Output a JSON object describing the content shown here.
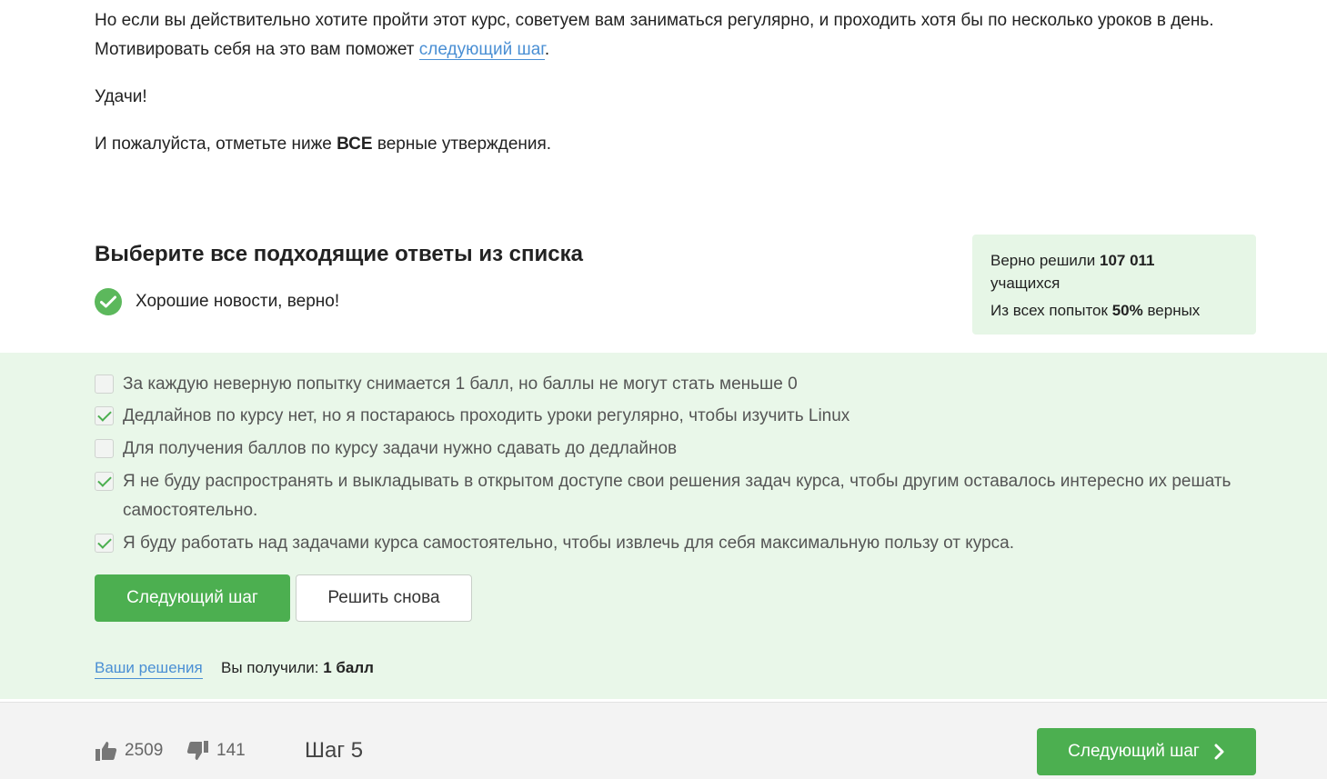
{
  "text": {
    "intro_cut": "Но если вы действительно хотите пройти этот курс, советуем вам заниматься регулярно, и проходить хотя бы по несколько уроков в",
    "intro_before": "Но если вы действительно хотите пройти этот курс, советуем вам заниматься регулярно, и проходить хотя бы по несколько уроков в день. Мотивировать себя на это вам поможет ",
    "intro_link": "следующий шаг",
    "intro_after": ".",
    "luck": "Удачи!",
    "mark_before": "И пожалуйста, отметьте ниже ",
    "mark_bold": "ВСЕ",
    "mark_after": " верные утверждения."
  },
  "quiz": {
    "title": "Выберите все подходящие ответы из списка",
    "result": "Хорошие новости, верно!",
    "options": [
      {
        "label": "За каждую неверную попытку снимается 1 балл, но баллы не могут стать меньше 0",
        "checked": false
      },
      {
        "label": "Дедлайнов по курсу нет, но я постараюсь проходить уроки регулярно, чтобы изучить Linux",
        "checked": true
      },
      {
        "label": "Для получения баллов по курсу задачи нужно сдавать до дедлайнов",
        "checked": false
      },
      {
        "label": "Я не буду распространять и выкладывать в открытом доступе свои решения задач курса, чтобы другим оставалось интересно их решать самостоятельно.",
        "checked": true
      },
      {
        "label": "Я буду работать над задачами курса самостоятельно, чтобы извлечь для себя максимальную пользу от курса.",
        "checked": true
      }
    ],
    "next_button": "Следующий шаг",
    "retry_button": "Решить снова",
    "solutions_link": "Ваши решения",
    "score_label": "Вы получили: ",
    "score_value": "1 балл"
  },
  "stats": {
    "solved_label": "Верно решили ",
    "solved_count": "107 011",
    "solved_suffix": "учащихся",
    "attempts_label": "Из всех попыток ",
    "attempts_pct": "50%",
    "attempts_suffix": " верных"
  },
  "footer": {
    "likes": "2509",
    "dislikes": "141",
    "step": "Шаг 5",
    "next_button": "Следующий шаг"
  },
  "colors": {
    "accent_green": "#4caf50",
    "band_green": "#e9f7e9",
    "link_blue": "#4a8fd4"
  },
  "icons": [
    "check-circle-icon",
    "checkbox-check-icon",
    "thumbs-up-icon",
    "thumbs-down-icon",
    "chevron-right-icon"
  ]
}
